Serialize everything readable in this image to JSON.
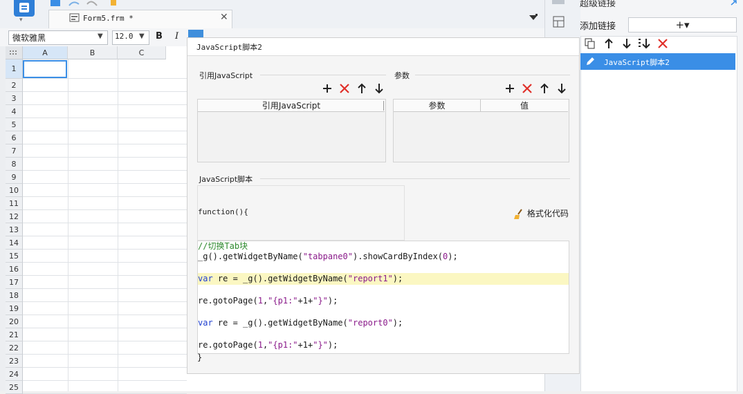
{
  "window": {
    "tab_title": "Form5.frm *"
  },
  "format_toolbar": {
    "font_name": "微软雅黑",
    "font_size": "12.0",
    "bold": "B",
    "italic": "I"
  },
  "sheet": {
    "columns": [
      "A",
      "B",
      "C"
    ],
    "rows": [
      "1",
      "2",
      "3",
      "4",
      "5",
      "6",
      "7",
      "8",
      "9",
      "10",
      "11",
      "12",
      "13",
      "14",
      "15",
      "16",
      "17",
      "18",
      "19",
      "20",
      "21",
      "22",
      "23",
      "24",
      "25"
    ]
  },
  "right_panel": {
    "title": "超级链接",
    "add_label": "添加链接",
    "add_button": "+▾",
    "items": [
      "JavaScript脚本2"
    ]
  },
  "dialog": {
    "title": "JavaScript脚本2",
    "ref_section": "引用JavaScript",
    "ref_table_header": "引用JavaScript",
    "param_section": "参数",
    "param_headers": [
      "参数",
      "值"
    ],
    "script_section": "JavaScript脚本",
    "function_header": "function(){",
    "format_button": "格式化代码",
    "code_lines": [
      "//切换Tab块",
      "_g().getWidgetByName(\"tabpane0\").showCardByIndex(0);",
      "var re = _g().getWidgetByName(\"report1\");",
      "re.gotoPage(1,\"{p1:\"+1+\"}\");",
      "var re = _g().getWidgetByName(\"report0\");",
      "re.gotoPage(1,\"{p1:\"+1+\"}\");"
    ],
    "closing_brace": "}"
  },
  "colors": {
    "accent": "#3a8ee6",
    "highlight_line": "#fbf7c2",
    "delete_red": "#e0302a"
  }
}
